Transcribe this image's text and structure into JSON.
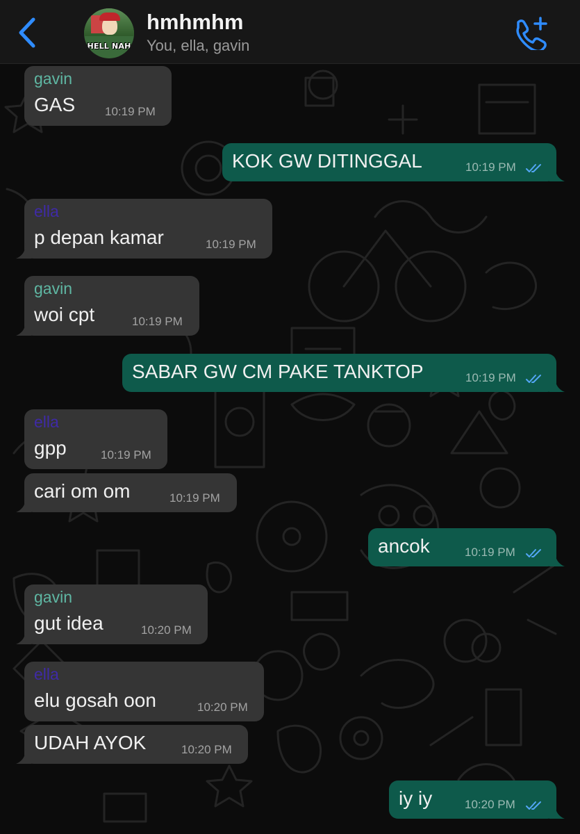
{
  "header": {
    "title": "hmhmhm",
    "members": "You, ella, gavin",
    "avatar_text": "HELL NAH",
    "back_icon": "chevron-left-icon",
    "call_icon": "phone-add-icon",
    "accent": "#2f8cff"
  },
  "colors": {
    "background": "#0c0c0c",
    "incoming_bubble": "#353535",
    "outgoing_bubble": "#0e5a4b",
    "gavin_name": "#5fb7a3",
    "ella_name": "#3f2aa6",
    "read_ticks": "#53a6f5"
  },
  "messages": [
    {
      "direction": "in",
      "sender": "gavin",
      "text": "GAS",
      "time": "10:19 PM"
    },
    {
      "direction": "out",
      "text": "KOK GW DITINGGAL",
      "time": "10:19 PM",
      "status": "read"
    },
    {
      "direction": "in",
      "sender": "ella",
      "text": "p depan kamar",
      "time": "10:19 PM"
    },
    {
      "direction": "in",
      "sender": "gavin",
      "text": "woi cpt",
      "time": "10:19 PM"
    },
    {
      "direction": "out",
      "text": "SABAR GW CM PAKE TANKTOP",
      "time": "10:19 PM",
      "status": "read"
    },
    {
      "direction": "in",
      "sender": "ella",
      "text": "gpp",
      "time": "10:19 PM"
    },
    {
      "direction": "in",
      "text": "cari om om",
      "time": "10:19 PM"
    },
    {
      "direction": "out",
      "text": "ancok",
      "time": "10:19 PM",
      "status": "read"
    },
    {
      "direction": "in",
      "sender": "gavin",
      "text": "gut idea",
      "time": "10:20 PM"
    },
    {
      "direction": "in",
      "sender": "ella",
      "text": "elu gosah oon",
      "time": "10:20 PM"
    },
    {
      "direction": "in",
      "text": "UDAH AYOK",
      "time": "10:20 PM"
    },
    {
      "direction": "out",
      "text": "iy iy",
      "time": "10:20 PM",
      "status": "read"
    }
  ]
}
